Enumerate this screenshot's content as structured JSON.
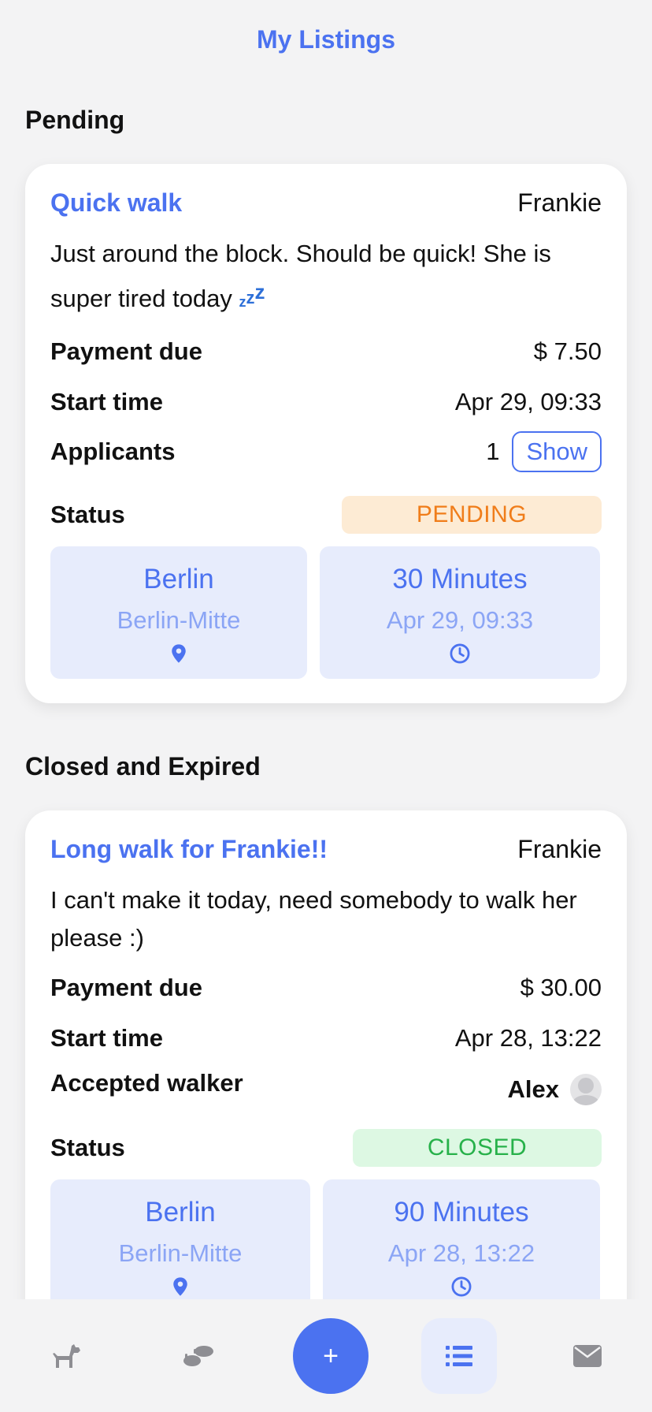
{
  "header": {
    "title": "My Listings"
  },
  "sections": {
    "pending_title": "Pending",
    "closed_title": "Closed and Expired"
  },
  "listings": [
    {
      "title": "Quick walk",
      "dog": "Frankie",
      "description": "Just around the block. Should be quick! She is super tired today",
      "description_emoji": "💤",
      "payment_label": "Payment due",
      "payment_value": "$ 7.50",
      "start_label": "Start time",
      "start_value": "Apr 29, 09:33",
      "applicants_label": "Applicants",
      "applicants_count": "1",
      "show_label": "Show",
      "status_label": "Status",
      "status_value": "PENDING",
      "status_color": "#f07d1a",
      "city": "Berlin",
      "district": "Berlin-Mitte",
      "duration": "30 Minutes",
      "duration_date": "Apr 29, 09:33"
    },
    {
      "title": "Long walk for Frankie!!",
      "dog": "Frankie",
      "description": "I can't make it today, need somebody to walk her please :)",
      "payment_label": "Payment due",
      "payment_value": "$ 30.00",
      "start_label": "Start time",
      "start_value": "Apr 28, 13:22",
      "walker_label": "Accepted walker",
      "walker_name": "Alex",
      "status_label": "Status",
      "status_value": "CLOSED",
      "status_color": "#27b14a",
      "city": "Berlin",
      "district": "Berlin-Mitte",
      "duration": "90 Minutes",
      "duration_date": "Apr 28, 13:22"
    }
  ],
  "tabbar": {
    "add_label": "+",
    "icons": [
      "dog-icon",
      "footprints-icon",
      "add-icon",
      "list-icon",
      "mail-icon"
    ],
    "active": "list-icon",
    "accent": "#4b72f0"
  }
}
